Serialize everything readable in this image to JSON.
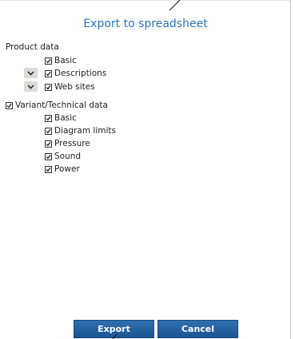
{
  "dialog": {
    "title": "Export to spreadsheet",
    "product_data": {
      "label": "Product data",
      "items": [
        {
          "label": "Basic",
          "checked": true
        },
        {
          "label": "Descriptions",
          "checked": true
        },
        {
          "label": "Web sites",
          "checked": true
        }
      ]
    },
    "variant_data": {
      "label": "Variant/Technical data",
      "checked": true,
      "items": [
        {
          "label": "Basic",
          "checked": true
        },
        {
          "label": "Diagram limits",
          "checked": true
        },
        {
          "label": "Pressure",
          "checked": true
        },
        {
          "label": "Sound",
          "checked": true
        },
        {
          "label": "Power",
          "checked": true
        }
      ]
    },
    "buttons": {
      "export_label": "Export",
      "cancel_label": "Cancel"
    }
  }
}
